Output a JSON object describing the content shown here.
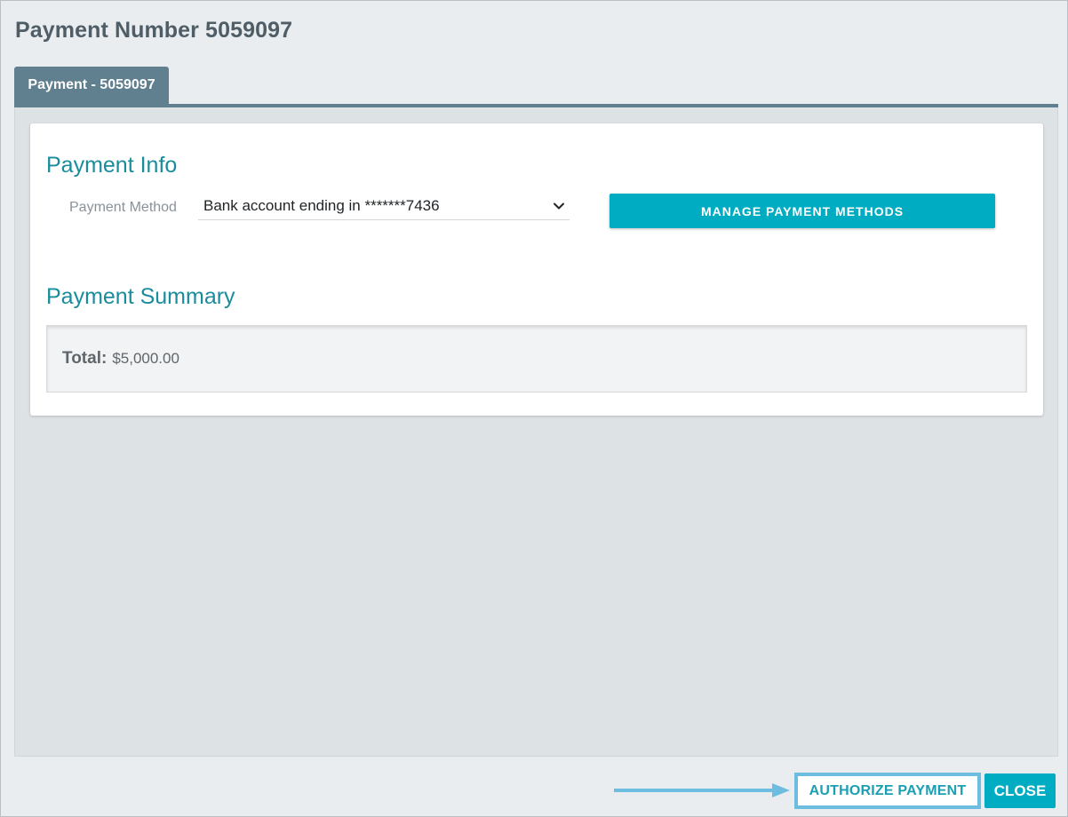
{
  "dialog": {
    "title": "Payment Number 5059097"
  },
  "tabs": [
    {
      "label": "Payment - 5059097",
      "active": true
    }
  ],
  "payment_info": {
    "heading": "Payment Info",
    "method_label": "Payment Method",
    "method_value": "Bank account ending in *******7436",
    "manage_button": "MANAGE PAYMENT METHODS"
  },
  "payment_summary": {
    "heading": "Payment Summary",
    "total_label": "Total:",
    "total_value": "$5,000.00"
  },
  "footer": {
    "authorize_button": "AUTHORIZE PAYMENT",
    "close_button": "CLOSE"
  },
  "icons": {
    "dropdown": "chevron-down-icon",
    "annotation": "arrow-right-icon"
  },
  "colors": {
    "accent": "#00acc1",
    "heading": "#1a8c9c",
    "tab": "#61808f",
    "highlight": "#6cbde0"
  }
}
